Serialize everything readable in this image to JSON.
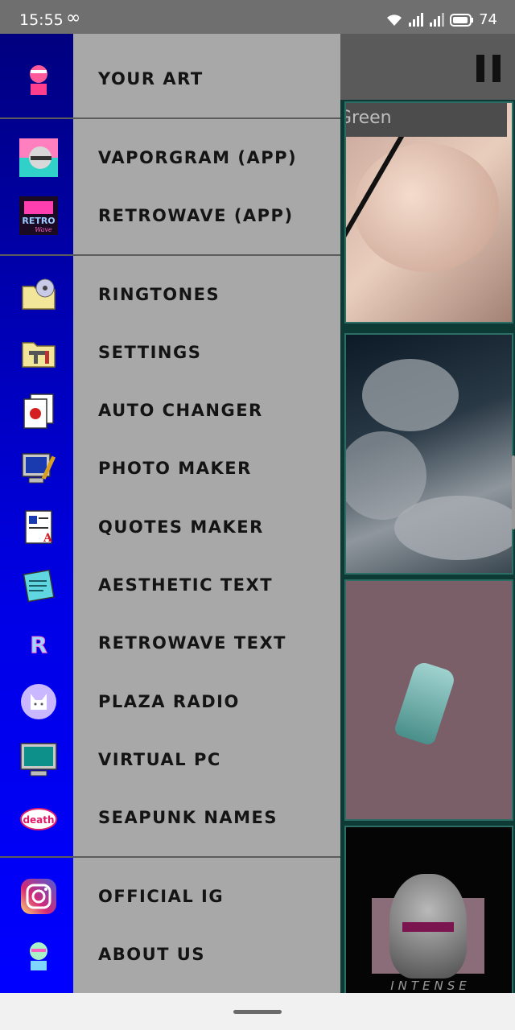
{
  "status_bar": {
    "time": "15:55",
    "infinity": "∞",
    "battery": "74"
  },
  "background": {
    "tile_label": "Green",
    "tile_caption": "INTENSE"
  },
  "drawer": {
    "sections": [
      {
        "items": [
          {
            "label": "YOUR ART",
            "icon": "statue-bust-icon"
          }
        ]
      },
      {
        "items": [
          {
            "label": "VAPORGRAM (APP)",
            "icon": "vaporgram-app-icon"
          },
          {
            "label": "RETROWAVE (APP)",
            "icon": "retrowave-app-icon"
          }
        ]
      },
      {
        "items": [
          {
            "label": "RINGTONES",
            "icon": "folder-cd-icon"
          },
          {
            "label": "SETTINGS",
            "icon": "folder-tools-icon"
          },
          {
            "label": "AUTO CHANGER",
            "icon": "documents-icon"
          },
          {
            "label": "PHOTO MAKER",
            "icon": "paint-monitor-icon"
          },
          {
            "label": "QUOTES MAKER",
            "icon": "document-write-icon"
          },
          {
            "label": "AESTHETIC TEXT",
            "icon": "notepad-icon"
          },
          {
            "label": "RETROWAVE TEXT",
            "icon": "retro-r-icon"
          },
          {
            "label": "PLAZA RADIO",
            "icon": "plaza-cat-icon"
          },
          {
            "label": "VIRTUAL PC",
            "icon": "monitor-icon"
          },
          {
            "label": "SEAPUNK NAMES",
            "icon": "death-water-icon"
          }
        ]
      },
      {
        "items": [
          {
            "label": "OFFICIAL IG",
            "icon": "instagram-icon"
          },
          {
            "label": "ABOUT US",
            "icon": "statue-bust-color-icon"
          }
        ]
      }
    ]
  },
  "colors": {
    "rail_top": "#00007f",
    "rail_bottom": "#0000ff",
    "drawer_bg": "#a8a8a8"
  }
}
